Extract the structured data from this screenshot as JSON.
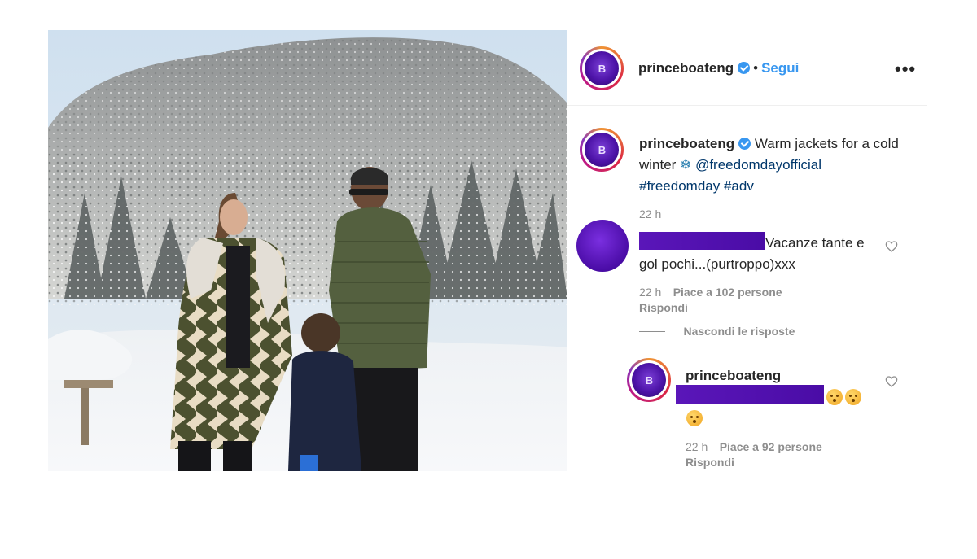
{
  "post": {
    "username": "princeboateng",
    "follow_label": "Segui",
    "separator": "•",
    "more_label": "•••"
  },
  "caption": {
    "username": "princeboateng",
    "text": "Warm jackets for a cold winter",
    "snowflake": "❄",
    "mention": "@freedomdayofficial",
    "hashtags": "#freedomday #adv",
    "time": "22 h"
  },
  "comments": [
    {
      "text": "Vacanze tante e gol pochi...(purtroppo)xxx",
      "time": "22 h",
      "likes": "Piace a 102 persone",
      "reply_label": "Rispondi",
      "hide_replies_label": "Nascondi le risposte"
    }
  ],
  "reply": {
    "username": "princeboateng",
    "time": "22 h",
    "likes": "Piace a 92 persone",
    "reply_label": "Rispondi"
  },
  "icons": {
    "verified": "verified-badge-icon",
    "heart": "heart-outline-icon",
    "emoji": "face-with-open-mouth-emoji"
  },
  "colors": {
    "link": "#00376b",
    "follow": "#3897f0",
    "redaction": "#5a16b9"
  }
}
